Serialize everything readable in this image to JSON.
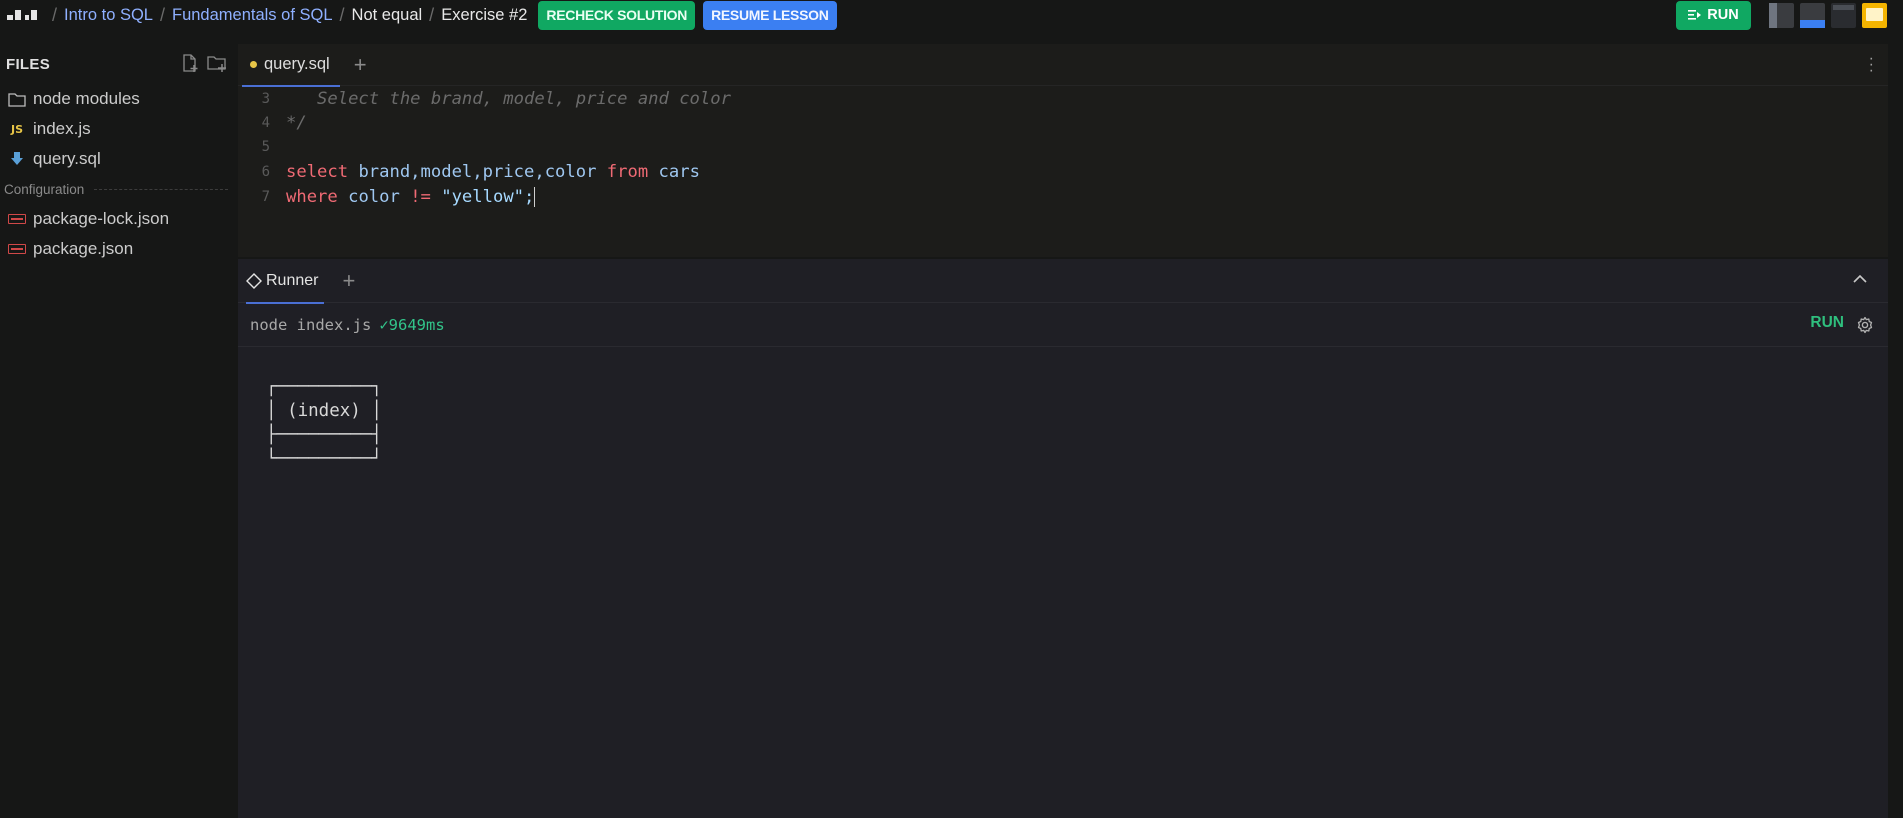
{
  "breadcrumb": [
    "Intro to SQL",
    "Fundamentals of SQL",
    "Not equal",
    "Exercise #2"
  ],
  "actions": {
    "recheck_label": "RECHECK SOLUTION",
    "resume_label": "RESUME LESSON",
    "run_label": "RUN"
  },
  "colors": {
    "accent_green": "#10a862",
    "accent_blue": "#3b7ff2",
    "link": "#8fb0ff",
    "background": "#161716"
  },
  "sidebar": {
    "title": "FILES",
    "items": [
      {
        "icon": "folder-icon",
        "label": "node modules"
      },
      {
        "icon": "js-file-icon",
        "label": "index.js"
      },
      {
        "icon": "sql-file-icon",
        "label": "query.sql"
      }
    ],
    "section": "Configuration",
    "config_items": [
      {
        "icon": "json-file-icon",
        "label": "package-lock.json"
      },
      {
        "icon": "json-file-icon",
        "label": "package.json"
      }
    ]
  },
  "editor": {
    "tab_label": "query.sql",
    "lines": [
      {
        "n": "3",
        "text": "   Select the brand, model, price and color"
      },
      {
        "n": "4",
        "text": "*/"
      },
      {
        "n": "5",
        "text": ""
      },
      {
        "n": "6",
        "kw1": "select",
        "ids": " brand,model,price,color ",
        "kw2": "from",
        "table": " cars"
      },
      {
        "n": "7",
        "kw1": "where",
        "ids": " color ",
        "op": "!=",
        "str": " \"yellow\";"
      }
    ]
  },
  "runner": {
    "tab_label": "Runner",
    "command": "node index.js",
    "status": "✓9649ms",
    "run_label": "RUN",
    "output": "┌─────────┐\n│ (index) │\n├─────────┤\n└─────────┘"
  }
}
